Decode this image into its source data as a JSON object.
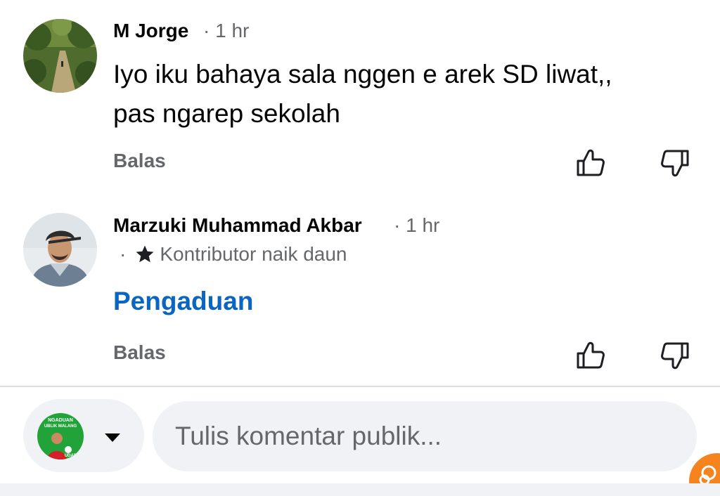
{
  "comments": [
    {
      "author": "M Jorge",
      "time": "· 1 hr",
      "text_line1": "Iyo iku bahaya sala nggen e arek SD liwat,,",
      "text_line2": "pas ngarep sekolah",
      "reply_label": "Balas",
      "avatar_icon": "forest-path-photo"
    },
    {
      "author": "Marzuki Muhammad Akbar",
      "time": "· 1 hr",
      "badge_prefix": "·",
      "badge": "Kontributor naik daun",
      "badge_icon": "star-icon",
      "link_text": "Pengaduan",
      "reply_label": "Balas",
      "avatar_icon": "person-with-cap-photo"
    }
  ],
  "reaction_icons": [
    "thumbs-up-icon",
    "thumbs-down-icon"
  ],
  "composer": {
    "placeholder": "Tulis komentar publik...",
    "value": "",
    "avatar_logo_text_top": "NGADUAN",
    "avatar_logo_text_mid": "UBLIK MALANG",
    "avatar_logo_text_bottom": "UDARM"
  },
  "colors": {
    "link": "#0b65c2",
    "secondary_text": "#65676b",
    "pill_background": "#f0f2f5",
    "float_button": "#f5841f"
  }
}
